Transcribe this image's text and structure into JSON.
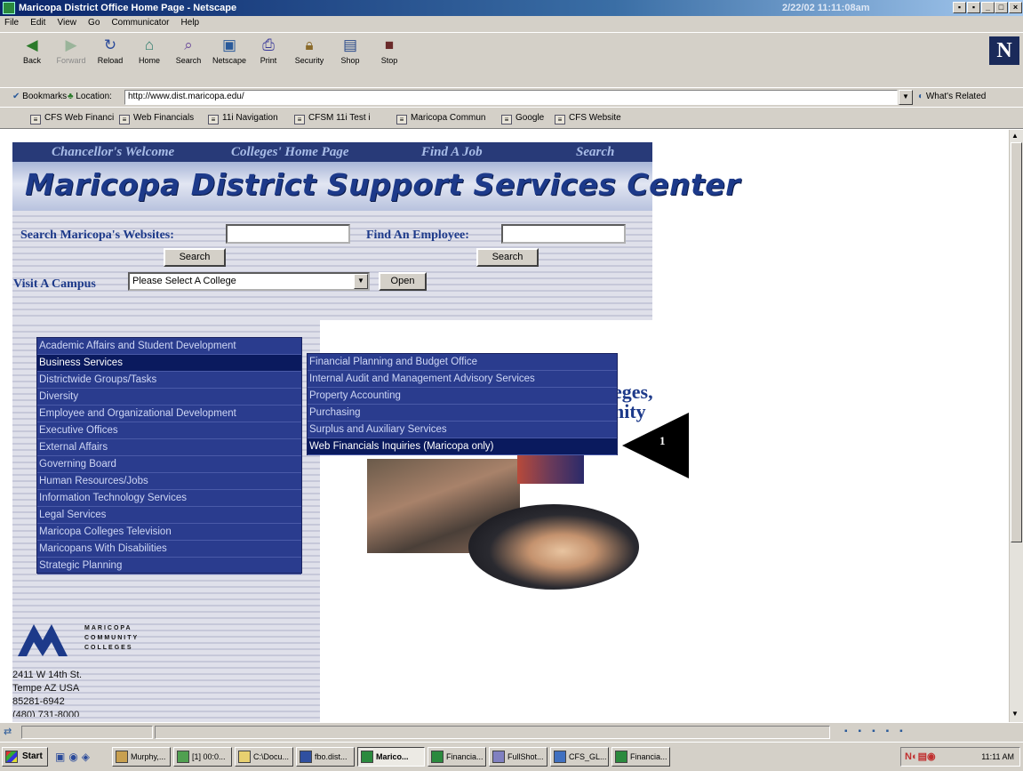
{
  "window": {
    "title": "Maricopa District Office Home Page - Netscape",
    "clock": "2/22/02 11:11:08am"
  },
  "menubar": [
    "File",
    "Edit",
    "View",
    "Go",
    "Communicator",
    "Help"
  ],
  "toolbar": [
    {
      "label": "Back",
      "icon": "back-arrow-icon"
    },
    {
      "label": "Forward",
      "icon": "forward-arrow-icon"
    },
    {
      "label": "Reload",
      "icon": "reload-icon"
    },
    {
      "label": "Home",
      "icon": "home-icon"
    },
    {
      "label": "Search",
      "icon": "search-icon"
    },
    {
      "label": "Netscape",
      "icon": "netscape-icon"
    },
    {
      "label": "Print",
      "icon": "print-icon"
    },
    {
      "label": "Security",
      "icon": "security-lock-icon"
    },
    {
      "label": "Shop",
      "icon": "shop-icon"
    },
    {
      "label": "Stop",
      "icon": "stop-icon"
    }
  ],
  "location": {
    "bookmarks_label": "Bookmarks",
    "location_label": "Location:",
    "url": "http://www.dist.maricopa.edu/",
    "whats_related": "What's Related"
  },
  "personal_toolbar": [
    "CFS Web Financi",
    "Web Financials",
    "11i Navigation",
    "CFSM 11i Test i",
    "Maricopa Commun",
    "Google",
    "CFS Website"
  ],
  "page": {
    "nav_links": [
      "Chancellor's Welcome",
      "Colleges' Home Page",
      "Find A Job",
      "Search"
    ],
    "banner_title": "Maricopa District Support Services Center",
    "search_websites_label": "Search Maricopa's Websites:",
    "find_employee_label": "Find An Employee:",
    "search_button": "Search",
    "visit_campus_label": "Visit A Campus",
    "campus_select_value": "Please Select A College",
    "open_button": "Open",
    "main_menu": [
      "Academic Affairs and Student Development",
      "Business Services",
      "Districtwide Groups/Tasks",
      "Diversity",
      "Employee and Organizational Development",
      "Executive Offices",
      "External Affairs",
      "Governing Board",
      "Human Resources/Jobs",
      "Information Technology Services",
      "Legal Services",
      "Maricopa Colleges Television",
      "Maricopans With Disabilities",
      "Strategic Planning"
    ],
    "main_menu_selected": 1,
    "sub_menu": [
      "Financial Planning and Budget Office",
      "Internal Audit and Management Advisory Services",
      "Property Accounting",
      "Purchasing",
      "Surplus and Auxiliary Services",
      "Web Financials Inquiries (Maricopa only)"
    ],
    "sub_menu_selected": 5,
    "partial_text_1": "eges,",
    "partial_text_2": "nity",
    "callout_number": "1",
    "logo_text": [
      "MARICOPA",
      "COMMUNITY",
      "COLLEGES"
    ],
    "address": [
      "2411 W 14th St.",
      "Tempe AZ USA",
      "85281-6942",
      "(480) 731-8000"
    ]
  },
  "taskbar": {
    "start": "Start",
    "tasks": [
      "Murphy,...",
      "[1] 00:0...",
      "C:\\Docu...",
      "fbo.dist...",
      "Marico...",
      "Financia...",
      "FullShot...",
      "CFS_GL...",
      "Financia..."
    ],
    "active_task": 4,
    "time": "11:11 AM"
  }
}
